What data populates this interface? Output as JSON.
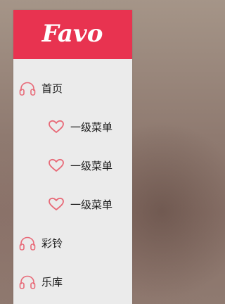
{
  "logo": {
    "text": "Favo",
    "color": "#e83350"
  },
  "menu": {
    "accent_color": "#e86a78",
    "items": [
      {
        "label": "首页",
        "icon": "headphones-icon",
        "level": 1
      },
      {
        "label": "一级菜单",
        "icon": "heart-icon",
        "level": 2
      },
      {
        "label": "一级菜单",
        "icon": "heart-icon",
        "level": 2
      },
      {
        "label": "一级菜单",
        "icon": "heart-icon",
        "level": 2
      },
      {
        "label": "彩铃",
        "icon": "headphones-icon",
        "level": 1
      },
      {
        "label": "乐库",
        "icon": "headphones-icon",
        "level": 1
      }
    ]
  }
}
